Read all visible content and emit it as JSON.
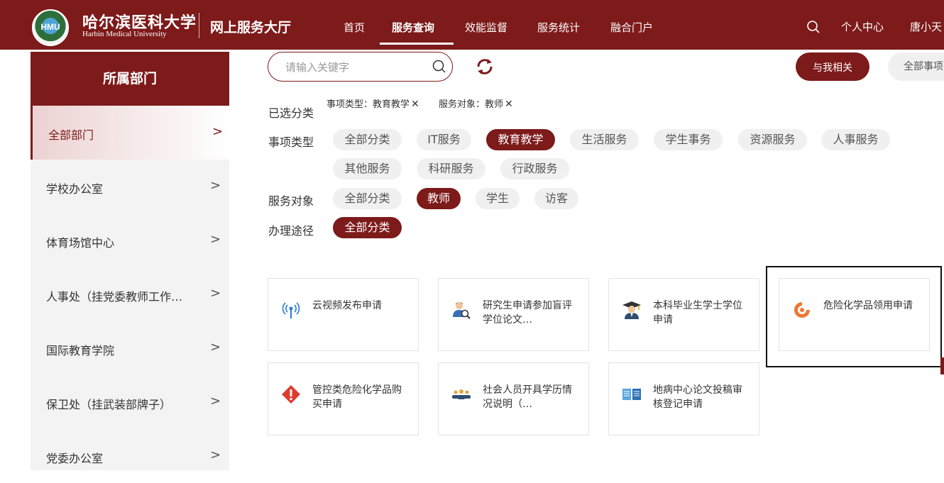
{
  "header": {
    "logo_badge": "HMU",
    "logo_cn": "哈尔滨医科大学",
    "logo_en": "Harbin Medical University",
    "site_title": "网上服务大厅",
    "nav": [
      "首页",
      "服务查询",
      "效能监督",
      "服务统计",
      "融合门户"
    ],
    "active_nav": "服务查询",
    "personal_center": "个人中心",
    "username": "唐小天"
  },
  "sidebar": {
    "title": "所属部门",
    "items": [
      {
        "label": "全部部门",
        "active": true
      },
      {
        "label": "学校办公室"
      },
      {
        "label": "体育场馆中心"
      },
      {
        "label": "人事处（挂党委教师工作…"
      },
      {
        "label": "国际教育学院"
      },
      {
        "label": "保卫处（挂武装部牌子）"
      },
      {
        "label": "党委办公室"
      }
    ],
    "chevron": ">"
  },
  "search": {
    "placeholder": "请输入关键字",
    "value": ""
  },
  "buttons": {
    "related": "与我相关",
    "all_items": "全部事项"
  },
  "filters": {
    "selected_label": "已选分类",
    "selected_tags": [
      "事项类型：教育教学",
      "服务对象：教师"
    ],
    "remove_symbol": "✕",
    "type_label": "事项类型",
    "type_options": [
      "全部分类",
      "IT服务",
      "教育教学",
      "生活服务",
      "学生事务",
      "资源服务",
      "人事服务",
      "其他服务",
      "科研服务",
      "行政服务"
    ],
    "type_selected": "教育教学",
    "audience_label": "服务对象",
    "audience_options": [
      "全部分类",
      "教师",
      "学生",
      "访客"
    ],
    "audience_selected": "教师",
    "channel_label": "办理途径",
    "channel_options": [
      "全部分类"
    ],
    "channel_selected": "全部分类"
  },
  "cards": [
    {
      "title": "云视频发布申请",
      "icon": "broadcast-icon"
    },
    {
      "title": "研究生申请参加盲评学位论文…",
      "icon": "researcher-icon"
    },
    {
      "title": "本科毕业生学士学位申请",
      "icon": "graduate-icon"
    },
    {
      "title": "危险化学品领用申请",
      "icon": "hazard-orange-icon"
    },
    {
      "title": "管控类危险化学品购买申请",
      "icon": "warning-icon"
    },
    {
      "title": "社会人员开具学历情况说明（…",
      "icon": "people-icon"
    },
    {
      "title": "地病中心论文投稿审核登记申请",
      "icon": "book-icon"
    }
  ],
  "colors": {
    "primary": "#7d1a1a",
    "chip_bg": "#f0f0f0",
    "sidebar_bg": "#f3f3f3"
  }
}
